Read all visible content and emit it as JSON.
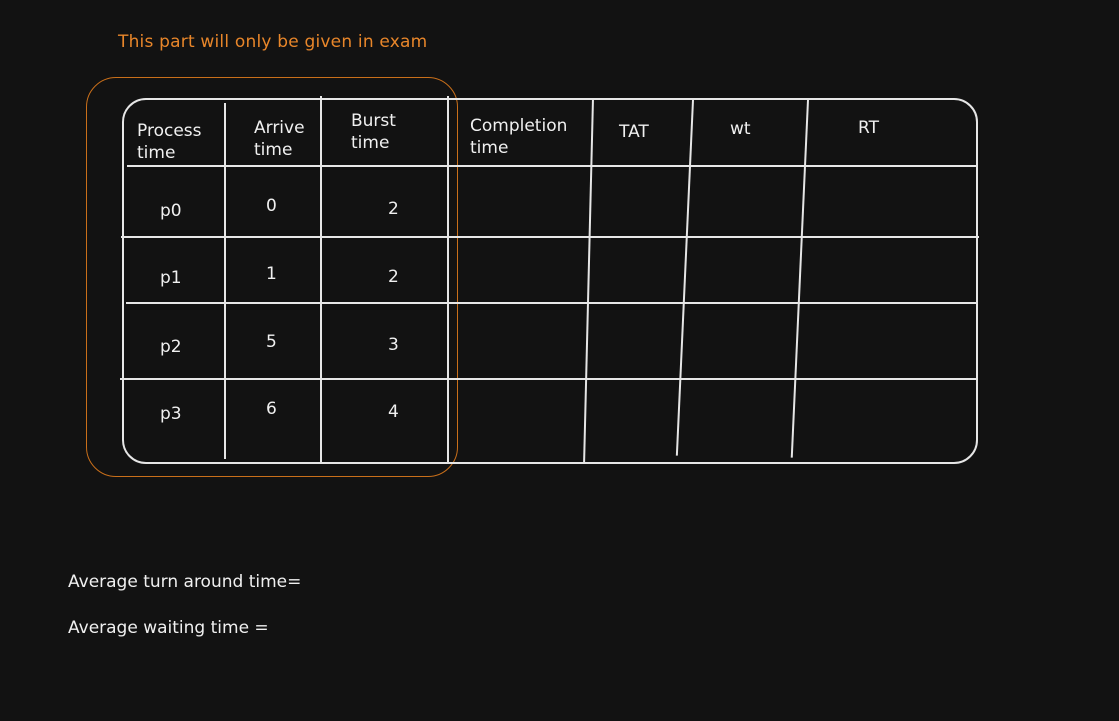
{
  "annotation": "This part will only be given in exam",
  "table": {
    "headers": {
      "process": "Process\ntime",
      "arrive": "Arrive\ntime",
      "burst": "Burst\ntime",
      "completion": "Completion\ntime",
      "tat": "TAT",
      "wt": "wt",
      "rt": "RT"
    },
    "rows": [
      {
        "process": "p0",
        "arrive": "0",
        "burst": "2"
      },
      {
        "process": "p1",
        "arrive": "1",
        "burst": "2"
      },
      {
        "process": "p2",
        "arrive": "5",
        "burst": "3"
      },
      {
        "process": "p3",
        "arrive": "6",
        "burst": "4"
      }
    ]
  },
  "summary": {
    "avg_tat": "Average turn around time=",
    "avg_wt": "Average waiting time ="
  },
  "colors": {
    "background": "#121212",
    "stroke": "#e6e6e6",
    "accent": "#c96f1a"
  }
}
